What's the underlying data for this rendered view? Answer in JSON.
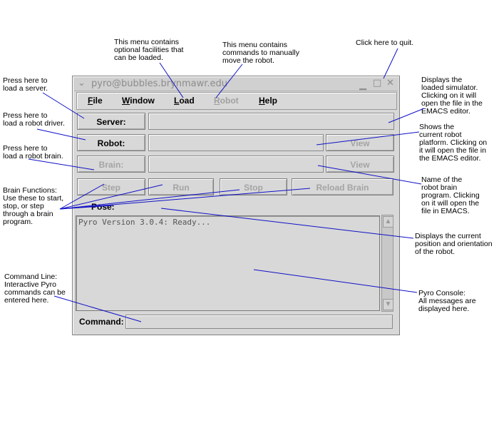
{
  "window": {
    "title": "pyro@bubbles.brynmawr.edu",
    "menu_icon": "chevron-down-icon",
    "controls": [
      "minimize-icon",
      "maximize-icon",
      "close-icon"
    ]
  },
  "menu": [
    {
      "label": "File",
      "underline": "F",
      "rest": "ile",
      "enabled": true
    },
    {
      "label": "Window",
      "underline": "W",
      "rest": "indow",
      "enabled": true
    },
    {
      "label": "Load",
      "underline": "L",
      "rest": "oad",
      "enabled": true
    },
    {
      "label": "Robot",
      "underline": "R",
      "rest": "obot",
      "enabled": false
    },
    {
      "label": "Help",
      "underline": "H",
      "rest": "elp",
      "enabled": true
    }
  ],
  "rows": {
    "server_button": "Server:",
    "robot_button": "Robot:",
    "brain_button": "Brain:",
    "robot_view": "View",
    "brain_view": "View"
  },
  "brain_functions": {
    "step": "Step",
    "run": "Run",
    "stop": "Stop",
    "reload": "Reload Brain"
  },
  "pose_label": "Pose:",
  "console_text": "Pyro Version 3.0.4: Ready...",
  "command_label": "Command:",
  "annotations": {
    "load_menu": "This menu contains\noptional facilities that\ncan be loaded.",
    "robot_menu": "This menu contains\ncommands to manually\nmove the robot.",
    "quit": "Click here to quit.",
    "server_press": "Press here to\nload a server.",
    "simulator": "Displays the\nloaded simulator.\nClicking on it will\nopen the file in the\nEMACS editor.",
    "robot_press": "Press here to\nload a robot driver.",
    "platform": "Shows the\ncurrent robot\nplatform. Clicking on\nit will open the file in\nthe EMACS editor.",
    "brain_press": "Press here to\nload a robot brain.",
    "brain_name": "Name of the\nrobot brain\nprogram. Clicking\non it will open the\nfile in EMACS.",
    "brain_functions": "Brain Functions:\nUse these to start,\nstop, or step\nthrough a brain\nprogram.",
    "pose": "Displays the current\nposition and orientation\nof the robot.",
    "command_line": "Command Line:\nInteractive Pyro\ncommands can be\nentered here.",
    "console": "Pyro Console:\nAll messages are\ndisplayed here."
  },
  "colors": {
    "leader_line": "#1010c8",
    "window_bg": "#d8d8d8",
    "disabled_text": "#a4a4a4"
  }
}
